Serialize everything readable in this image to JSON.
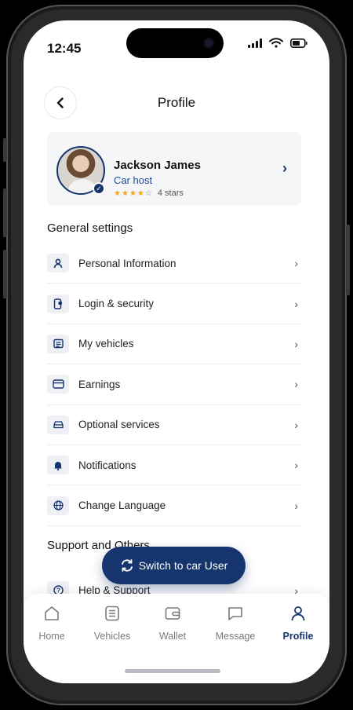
{
  "status": {
    "time": "12:45"
  },
  "header": {
    "title": "Profile"
  },
  "profile": {
    "name": "Jackson James",
    "role": "Car host",
    "rating": 4,
    "rating_max": 5,
    "rating_text": "4 stars"
  },
  "general": {
    "title": "General settings",
    "items": [
      {
        "label": "Personal Information",
        "icon": "person-icon"
      },
      {
        "label": "Login & security",
        "icon": "phone-lock-icon"
      },
      {
        "label": "My vehicles",
        "icon": "document-icon"
      },
      {
        "label": "Earnings",
        "icon": "card-icon"
      },
      {
        "label": "Optional services",
        "icon": "car-icon"
      },
      {
        "label": "Notifications",
        "icon": "bell-icon"
      },
      {
        "label": "Change Language",
        "icon": "globe-icon"
      }
    ]
  },
  "support": {
    "title": "Support and Others",
    "items": [
      {
        "label": "Help & Support",
        "icon": "help-icon"
      }
    ]
  },
  "fab": {
    "label": "Switch to car User"
  },
  "nav": [
    {
      "label": "Home",
      "icon": "home-icon",
      "active": false
    },
    {
      "label": "Vehicles",
      "icon": "vehicles-icon",
      "active": false
    },
    {
      "label": "Wallet",
      "icon": "wallet-icon",
      "active": false
    },
    {
      "label": "Message",
      "icon": "message-icon",
      "active": false
    },
    {
      "label": "Profile",
      "icon": "profile-icon",
      "active": true
    }
  ],
  "colors": {
    "primary": "#16356e",
    "star": "#f2a71b",
    "card_bg": "#f5f6f8"
  }
}
